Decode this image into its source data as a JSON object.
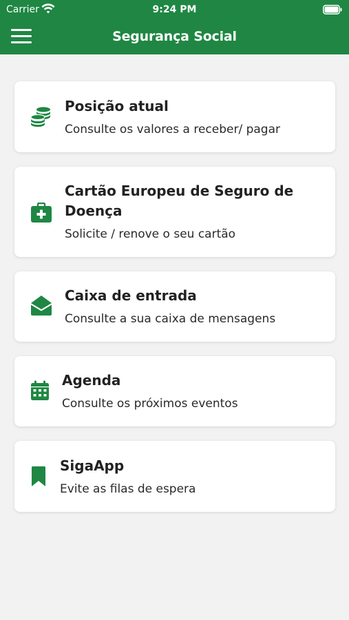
{
  "status_bar": {
    "carrier": "Carrier",
    "time": "9:24 PM"
  },
  "header": {
    "title": "Segurança Social",
    "menu_icon": "hamburger-menu-icon"
  },
  "colors": {
    "brand": "#1f8743",
    "background": "#f2f2f2",
    "card": "#ffffff"
  },
  "cards": [
    {
      "title": "Posição atual",
      "subtitle": "Consulte os valores a receber/ pagar",
      "icon": "coins-icon"
    },
    {
      "title": "Cartão Europeu de Seguro de Doença",
      "subtitle": "Solicite / renove o seu cartão",
      "icon": "medical-kit-icon"
    },
    {
      "title": "Caixa de entrada",
      "subtitle": "Consulte a sua caixa de mensagens",
      "icon": "envelope-open-icon"
    },
    {
      "title": "Agenda",
      "subtitle": "Consulte os próximos eventos",
      "icon": "calendar-icon"
    },
    {
      "title": "SigaApp",
      "subtitle": "Evite as filas de espera",
      "icon": "bookmark-icon"
    }
  ]
}
